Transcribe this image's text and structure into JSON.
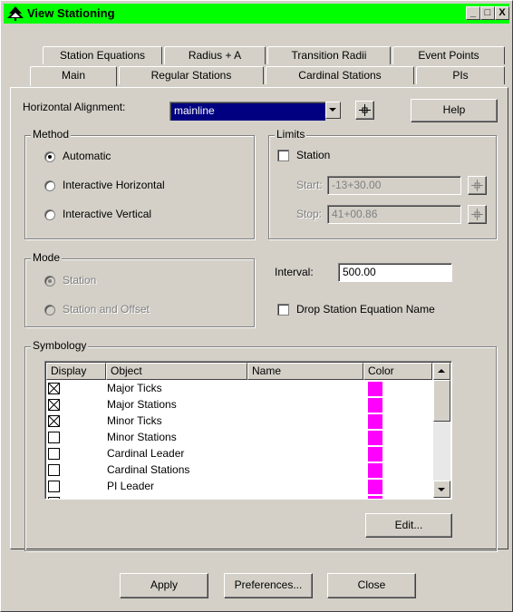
{
  "window": {
    "title": "View Stationing",
    "minimize_label": "_",
    "maximize_label": "□",
    "close_label": "X"
  },
  "tabs": {
    "back_row": [
      {
        "label": "Station Equations"
      },
      {
        "label": "Radius + A"
      },
      {
        "label": "Transition Radii"
      },
      {
        "label": "Event Points"
      }
    ],
    "front_row": [
      {
        "label": "Main",
        "active": true
      },
      {
        "label": "Regular Stations"
      },
      {
        "label": "Cardinal Stations"
      },
      {
        "label": "PIs"
      }
    ]
  },
  "alignment": {
    "label": "Horizontal Alignment:",
    "value": "mainline",
    "help_label": "Help"
  },
  "method": {
    "legend": "Method",
    "options": [
      {
        "label": "Automatic",
        "selected": true
      },
      {
        "label": "Interactive Horizontal",
        "selected": false
      },
      {
        "label": "Interactive Vertical",
        "selected": false
      }
    ]
  },
  "limits": {
    "legend": "Limits",
    "station_label": "Station",
    "station_checked": false,
    "start_label": "Start:",
    "start_value": "-13+30.00",
    "stop_label": "Stop:",
    "stop_value": "41+00.86"
  },
  "mode": {
    "legend": "Mode",
    "options": [
      {
        "label": "Station",
        "selected": true
      },
      {
        "label": "Station and Offset",
        "selected": false
      }
    ]
  },
  "interval": {
    "label": "Interval:",
    "value": "500.00"
  },
  "drop_equation": {
    "label": "Drop Station Equation Name",
    "checked": false
  },
  "symbology": {
    "legend": "Symbology",
    "columns": [
      "Display",
      "Object",
      "Name",
      "Color"
    ],
    "rows": [
      {
        "display": true,
        "object": "Major Ticks",
        "name": "",
        "color": "#ff00ff"
      },
      {
        "display": true,
        "object": "Major Stations",
        "name": "",
        "color": "#ff00ff"
      },
      {
        "display": true,
        "object": "Minor Ticks",
        "name": "",
        "color": "#ff00ff"
      },
      {
        "display": false,
        "object": "Minor Stations",
        "name": "",
        "color": "#ff00ff"
      },
      {
        "display": false,
        "object": "Cardinal Leader",
        "name": "",
        "color": "#ff00ff"
      },
      {
        "display": false,
        "object": "Cardinal Stations",
        "name": "",
        "color": "#ff00ff"
      },
      {
        "display": false,
        "object": "PI Leader",
        "name": "",
        "color": "#ff00ff"
      }
    ],
    "edit_label": "Edit..."
  },
  "footer": {
    "apply_label": "Apply",
    "preferences_label": "Preferences...",
    "close_label": "Close"
  },
  "colors": {
    "titlebar": "#00ff00",
    "face": "#d4d0c8",
    "selection": "#000080",
    "swatch": "#ff00ff"
  }
}
